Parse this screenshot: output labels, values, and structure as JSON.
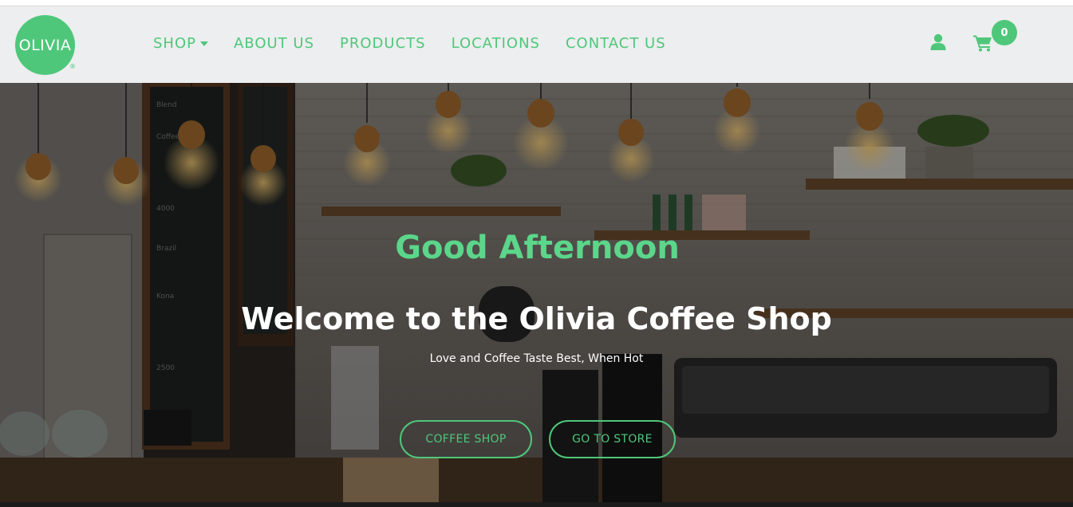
{
  "brand": {
    "logo_text": "OLIVIA",
    "registered_mark": "®",
    "accent_color": "#4fc77a",
    "logo_icon": "olivia-logo-circle"
  },
  "nav": {
    "items": [
      {
        "label": "SHOP",
        "has_dropdown": true
      },
      {
        "label": "ABOUT US"
      },
      {
        "label": "PRODUCTS"
      },
      {
        "label": "LOCATIONS"
      },
      {
        "label": "CONTACT US"
      }
    ],
    "user_icon": "user-icon",
    "cart_icon": "shopping-cart-icon",
    "cart_count": "0"
  },
  "hero": {
    "greeting": "Good Afternoon",
    "title": "Welcome to the Olivia Coffee Shop",
    "tagline": "Love and Coffee Taste Best, When Hot",
    "buttons": {
      "coffee_shop": "COFFEE SHOP",
      "go_to_store": "GO TO STORE"
    },
    "background": "coffee-shop-interior-image"
  }
}
